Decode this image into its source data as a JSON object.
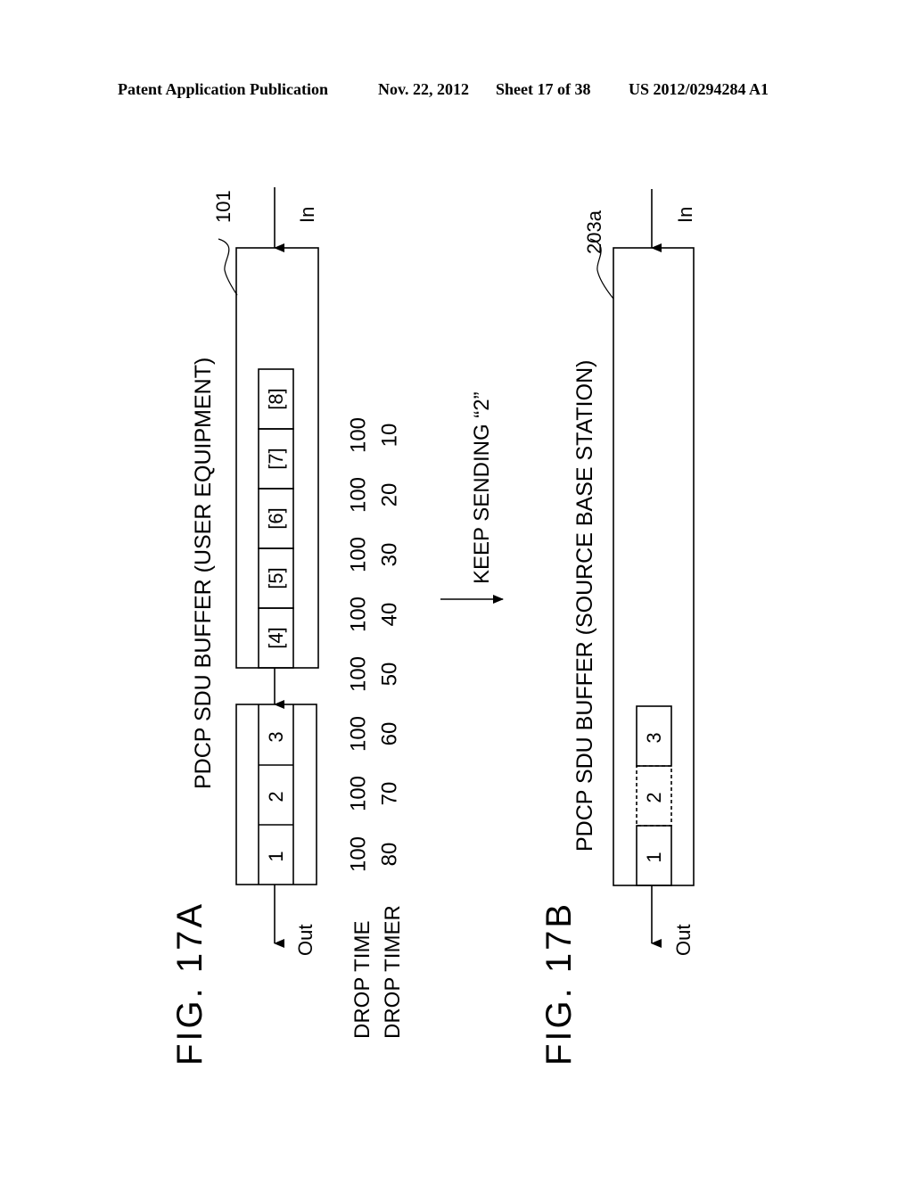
{
  "header": {
    "publication": "Patent Application Publication",
    "date": "Nov. 22, 2012",
    "sheet": "Sheet 17 of 38",
    "number": "US 2012/0294284 A1"
  },
  "fig_a": {
    "label": "FIG. 17A",
    "title": "PDCP SDU BUFFER (USER EQUIPMENT)",
    "ref": "101",
    "in_label": "In",
    "out_label": "Out",
    "queued_packets": [
      "[4]",
      "[5]",
      "[6]",
      "[7]",
      "[8]"
    ],
    "sending_packets": [
      "1",
      "2",
      "3"
    ],
    "row_labels": [
      "DROP TIME",
      "DROP TIMER"
    ],
    "drop_time": [
      "100",
      "100",
      "100",
      "100",
      "100",
      "100",
      "100",
      "100"
    ],
    "drop_timer": [
      "80",
      "70",
      "60",
      "50",
      "40",
      "30",
      "20",
      "10"
    ]
  },
  "transition": {
    "label": "KEEP SENDING “2”"
  },
  "fig_b": {
    "label": "FIG. 17B",
    "title": "PDCP SDU BUFFER (SOURCE BASE STATION)",
    "ref": "203a",
    "in_label": "In",
    "out_label": "Out",
    "packets": [
      "1",
      "2",
      "3"
    ]
  }
}
